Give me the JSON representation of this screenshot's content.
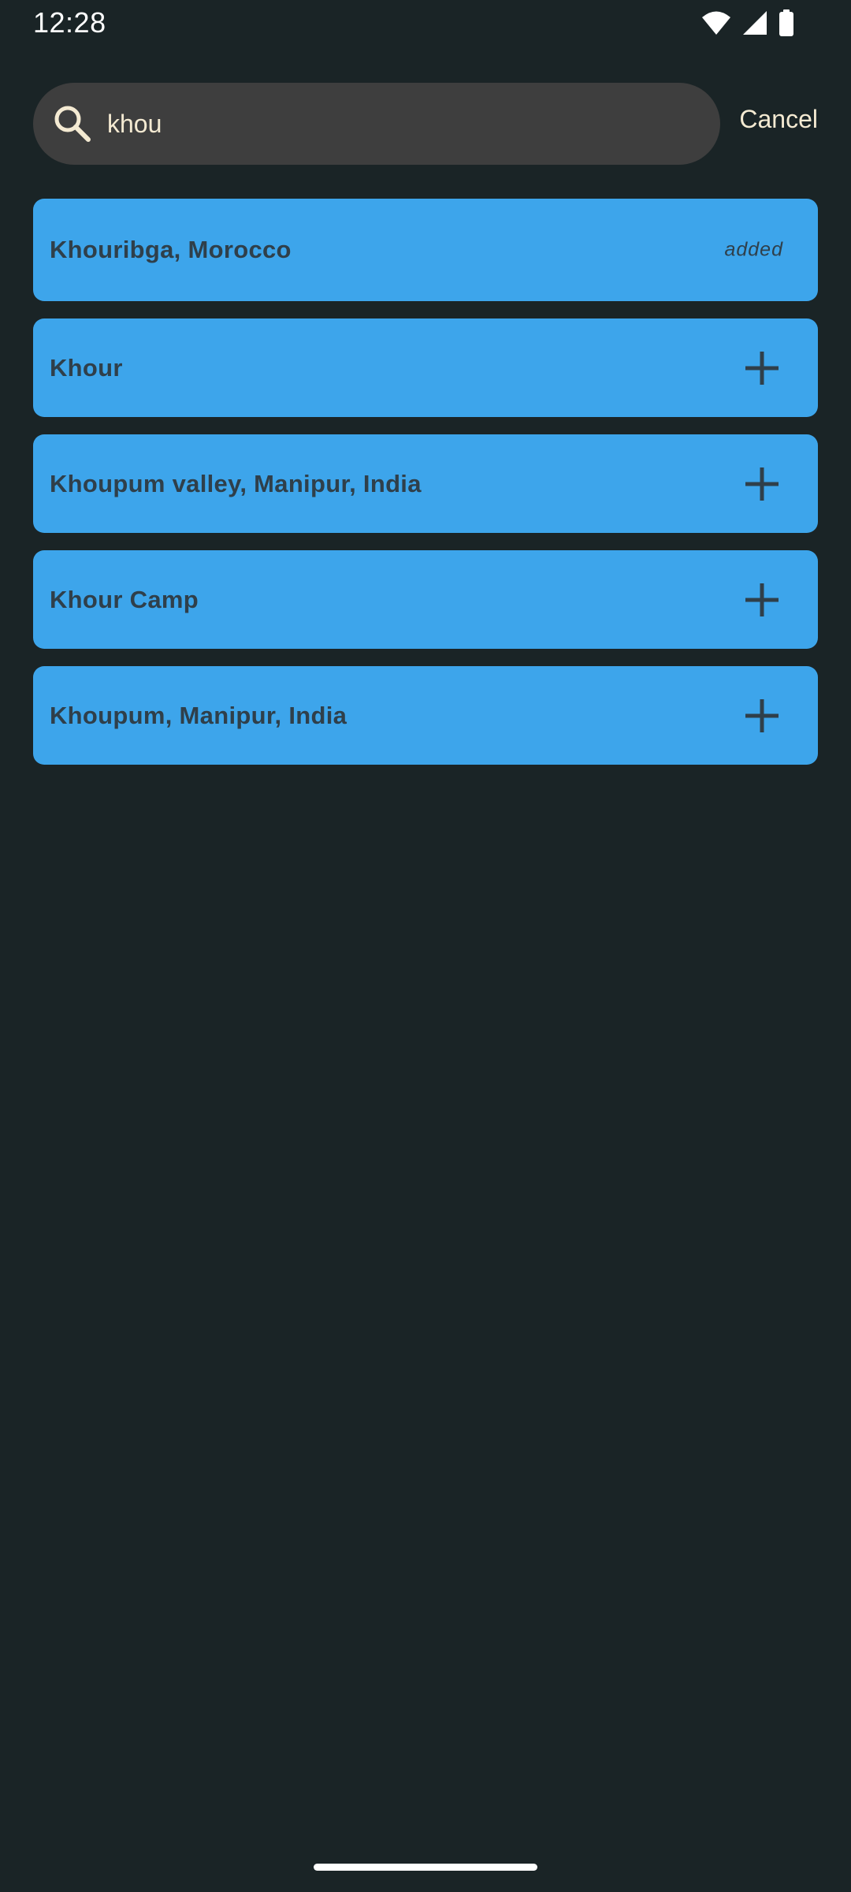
{
  "status_bar": {
    "time": "12:28",
    "icons": [
      "wifi-icon",
      "cellular-signal-icon",
      "battery-icon"
    ]
  },
  "search": {
    "icon": "search-icon",
    "value": "khou",
    "placeholder": "",
    "cancel_label": "Cancel"
  },
  "results": [
    {
      "label": "Khouribga, Morocco",
      "status": "added"
    },
    {
      "label": "Khour",
      "action_icon": "plus-icon"
    },
    {
      "label": "Khoupum valley, Manipur, India",
      "action_icon": "plus-icon"
    },
    {
      "label": "Khour Camp",
      "action_icon": "plus-icon"
    },
    {
      "label": "Khoupum, Manipur, India",
      "action_icon": "plus-icon"
    }
  ],
  "colors": {
    "background": "#1a2426",
    "search_box": "#3e3e3e",
    "search_text": "#f4ead2",
    "card": "#3da5eb",
    "card_text": "#2f3f4a"
  }
}
